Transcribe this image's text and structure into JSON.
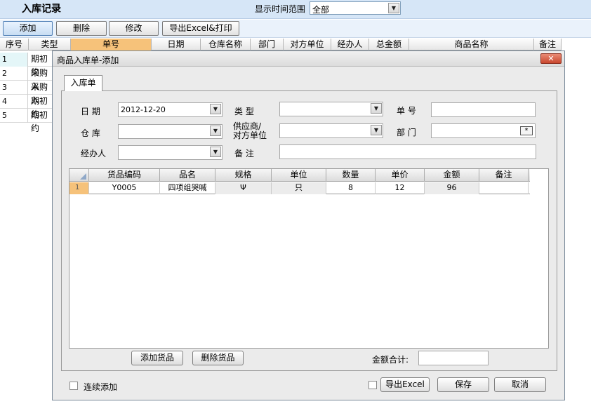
{
  "header": {
    "title": "入库记录",
    "range_label": "显示时间范围",
    "range_value": "全部"
  },
  "toolbar": {
    "add": "添加",
    "delete": "删除",
    "edit": "修改",
    "export_print": "导出Excel&打印"
  },
  "background_table": {
    "columns": [
      "序号",
      "类型",
      "单号",
      "日期",
      "仓库名称",
      "部门",
      "对方单位",
      "经办人",
      "总金额",
      "商品名称",
      "备注"
    ],
    "rows": [
      {
        "no": "1",
        "type": "期初约"
      },
      {
        "no": "2",
        "type": "采购入"
      },
      {
        "no": "3",
        "type": "采购入"
      },
      {
        "no": "4",
        "type": "期初约"
      },
      {
        "no": "5",
        "type": "期初约"
      }
    ]
  },
  "dialog": {
    "title": "商品入库单-添加",
    "close_symbol": "✕",
    "tab": "入库单",
    "fields": {
      "date_label": "日 期",
      "date_value": "2012-12-20",
      "type_label": "类 型",
      "type_value": "",
      "number_label": "单 号",
      "number_value": "",
      "warehouse_label": "仓 库",
      "warehouse_value": "",
      "supplier_label_1": "供应商/",
      "supplier_label_2": "对方单位",
      "supplier_value": "",
      "department_label": "部 门",
      "department_value": "",
      "handler_label": "经办人",
      "handler_value": "",
      "remark_label": "备 注",
      "remark_value": "",
      "picker_symbol": "*"
    },
    "grid": {
      "columns": [
        "货品编码",
        "品名",
        "规格",
        "单位",
        "数量",
        "单价",
        "金额",
        "备注"
      ],
      "rows": [
        {
          "rownum": "1",
          "code": "Y0005",
          "name": "四项组哭喊",
          "spec": "Ψ",
          "unit": "只",
          "qty": "8",
          "price": "12",
          "amount": "96",
          "remark": ""
        }
      ]
    },
    "add_item": "添加货品",
    "delete_item": "删除货品",
    "total_label": "金额合计:",
    "total_value": "",
    "continuous_add": "连续添加",
    "export_excel": "导出Excel",
    "save": "保存",
    "cancel": "取消"
  }
}
